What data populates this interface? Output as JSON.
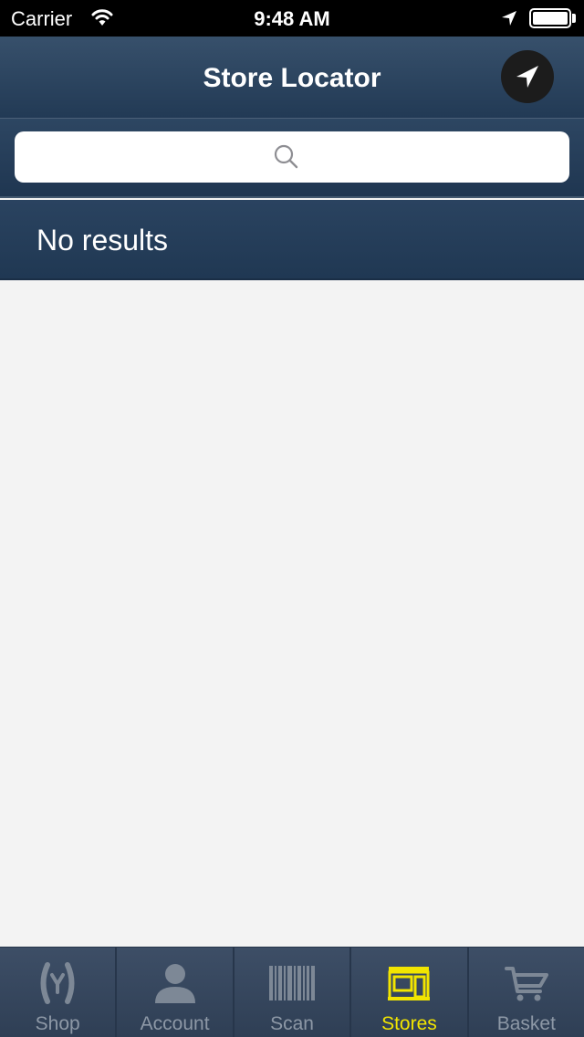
{
  "status_bar": {
    "carrier": "Carrier",
    "time": "9:48 AM",
    "icons": [
      "wifi-icon",
      "location-arrow-icon",
      "battery-icon"
    ]
  },
  "nav": {
    "title": "Store Locator",
    "locate_icon": "location-arrow-icon"
  },
  "search": {
    "value": "",
    "placeholder": "",
    "icon": "search-icon"
  },
  "results": {
    "label": "No results",
    "items": []
  },
  "tab_bar": {
    "active_tab": "Stores",
    "tabs": [
      {
        "label": "Shop",
        "icon": "shop-icon"
      },
      {
        "label": "Account",
        "icon": "person-icon"
      },
      {
        "label": "Scan",
        "icon": "barcode-icon"
      },
      {
        "label": "Stores",
        "icon": "storefront-icon"
      },
      {
        "label": "Basket",
        "icon": "basket-icon"
      }
    ]
  },
  "colors": {
    "nav_background": "#2b4360",
    "active_tab": "#f2e500",
    "inactive_tab": "#8d98a6",
    "list_background": "#f3f3f3"
  }
}
